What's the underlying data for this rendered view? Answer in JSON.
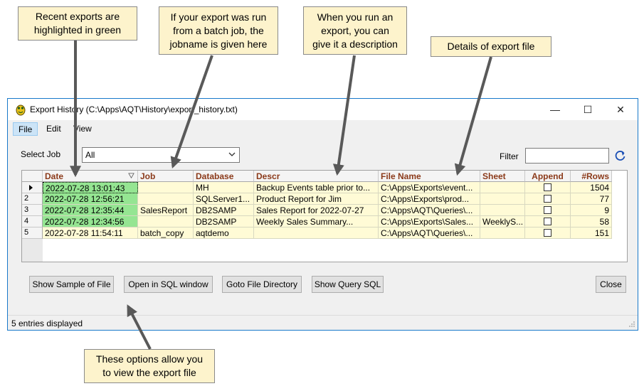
{
  "callouts": {
    "recent_exports": "Recent exports are\nhighlighted in green",
    "batch_job": "If your export was run\nfrom a batch job, the\njobname is given here",
    "description": "When you run an\nexport, you can\ngive it a description",
    "details": "Details of export file",
    "options": "These options allow you\nto view the export file"
  },
  "window": {
    "title": "Export History (C:\\Apps\\AQT\\History\\export_history.txt)",
    "minimize": "—",
    "maximize": "☐",
    "close": "✕"
  },
  "menu": {
    "file": "File",
    "edit": "Edit",
    "view": "View"
  },
  "toolbar": {
    "select_job_label": "Select Job",
    "select_job_value": "All",
    "filter_label": "Filter",
    "filter_value": ""
  },
  "grid": {
    "columns": {
      "date": "Date",
      "job": "Job",
      "database": "Database",
      "descr": "Descr",
      "file_name": "File Name",
      "sheet": "Sheet",
      "append": "Append",
      "rows": "#Rows"
    },
    "rows": [
      {
        "num": "",
        "date": "2022-07-28 13:01:43",
        "job": "",
        "database": "MH",
        "descr": "Backup Events table prior to...",
        "file_name": "C:\\Apps\\Exports\\event...",
        "sheet": "",
        "rows": "1504"
      },
      {
        "num": "2",
        "date": "2022-07-28 12:56:21",
        "job": "",
        "database": "SQLServer1...",
        "descr": "Product Report for Jim",
        "file_name": "C:\\Apps\\Exports\\prod...",
        "sheet": "",
        "rows": "77"
      },
      {
        "num": "3",
        "date": "2022-07-28 12:35:44",
        "job": "SalesReport",
        "database": "DB2SAMP",
        "descr": "Sales Report for 2022-07-27",
        "file_name": "C:\\Apps\\AQT\\Queries\\...",
        "sheet": "",
        "rows": "9"
      },
      {
        "num": "4",
        "date": "2022-07-28 12:34:56",
        "job": "",
        "database": "DB2SAMP",
        "descr": "Weekly Sales Summary...",
        "file_name": "C:\\Apps\\Exports\\Sales...",
        "sheet": "WeeklyS...",
        "rows": "58"
      },
      {
        "num": "5",
        "date": "2022-07-28 11:54:11",
        "job": "batch_copy",
        "database": "aqtdemo",
        "descr": "",
        "file_name": "C:\\Apps\\AQT\\Queries\\...",
        "sheet": "",
        "rows": "151"
      }
    ]
  },
  "buttons": {
    "show_sample": "Show Sample of File",
    "open_sql": "Open in SQL window",
    "goto_dir": "Goto File Directory",
    "show_query": "Show Query SQL",
    "close": "Close"
  },
  "status": {
    "text": "5 entries displayed"
  },
  "colors": {
    "recent_highlight": "#95e592",
    "row_background": "#fffbd6",
    "header_text": "#8b3a1a",
    "window_border": "#1979ca",
    "callout_background": "#fdf3cc",
    "arrow": "#595959"
  },
  "icons": {
    "app": "frog-icon",
    "refresh": "refresh-icon",
    "dropdown": "chevron-down-icon",
    "sort": "filter-funnel-icon",
    "row_pointer": "row-pointer-icon"
  }
}
